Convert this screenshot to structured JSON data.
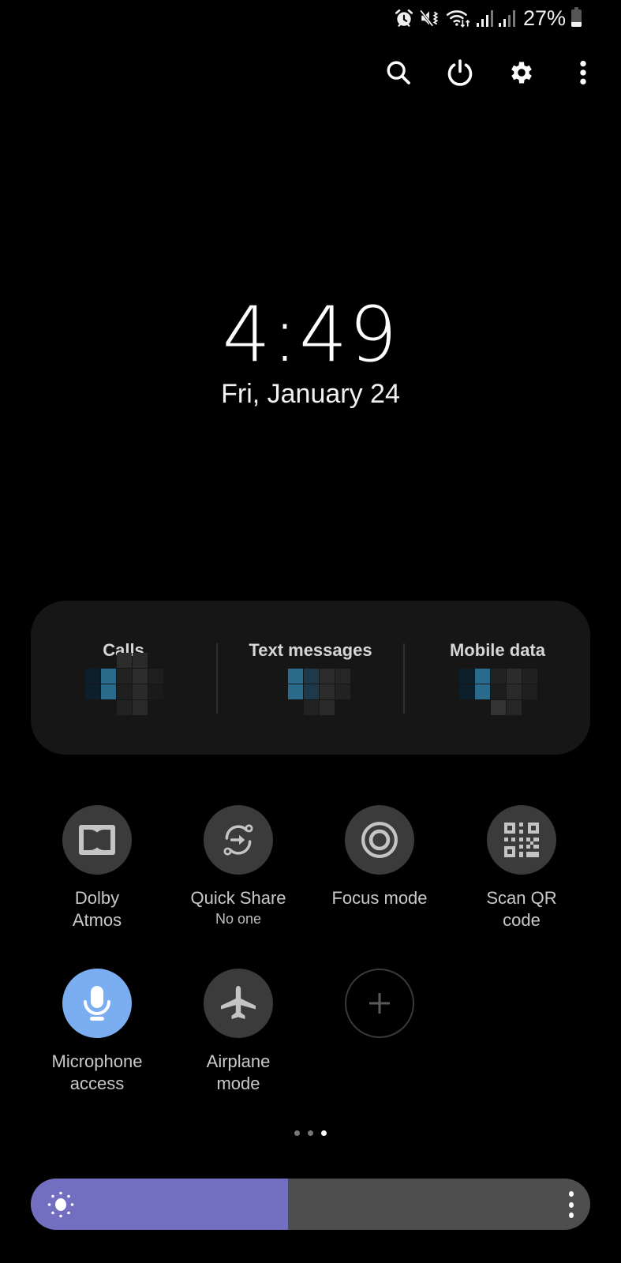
{
  "status_bar": {
    "icons": [
      "alarm-icon",
      "mute-vibrate-icon",
      "wifi-icon",
      "signal-sim1-icon",
      "signal-sim2-icon"
    ],
    "battery_percent_text": "27%",
    "battery_level": 0.27
  },
  "top_actions": [
    {
      "name": "search",
      "icon": "search-icon"
    },
    {
      "name": "power",
      "icon": "power-icon"
    },
    {
      "name": "settings",
      "icon": "gear-icon"
    },
    {
      "name": "more",
      "icon": "more-vertical-icon"
    }
  ],
  "clock": {
    "time": "4:49",
    "date": "Fri, January 24"
  },
  "usage": [
    {
      "label": "Calls",
      "value": "[pixelated]"
    },
    {
      "label": "Text messages",
      "value": "[pixelated]"
    },
    {
      "label": "Mobile data",
      "value": "[pixelated]"
    }
  ],
  "tiles": [
    {
      "id": "dolby",
      "label": "Dolby\nAtmos",
      "sub": "",
      "icon": "dolby-icon",
      "state": "off"
    },
    {
      "id": "quick-share",
      "label": "Quick Share",
      "sub": "No one",
      "icon": "quick-share-icon",
      "state": "off"
    },
    {
      "id": "focus",
      "label": "Focus mode",
      "sub": "",
      "icon": "focus-icon",
      "state": "off"
    },
    {
      "id": "qr",
      "label": "Scan QR\ncode",
      "sub": "",
      "icon": "qr-code-icon",
      "state": "off"
    },
    {
      "id": "mic",
      "label": "Microphone\naccess",
      "sub": "",
      "icon": "microphone-icon",
      "state": "on"
    },
    {
      "id": "airplane",
      "label": "Airplane\nmode",
      "sub": "",
      "icon": "airplane-icon",
      "state": "off"
    },
    {
      "id": "add",
      "label": "",
      "sub": "",
      "icon": "plus-icon",
      "state": "add"
    }
  ],
  "pager": {
    "count": 3,
    "current": 3
  },
  "brightness": {
    "level": 0.46,
    "icon": "sun-icon",
    "more_icon": "more-vertical-icon"
  },
  "colors": {
    "active_tile": "#7aaef0",
    "brightness_fill": "#736fc0",
    "brightness_track": "#4e4e4e",
    "tile_bg": "#3b3b3b",
    "card_bg": "#161616"
  }
}
